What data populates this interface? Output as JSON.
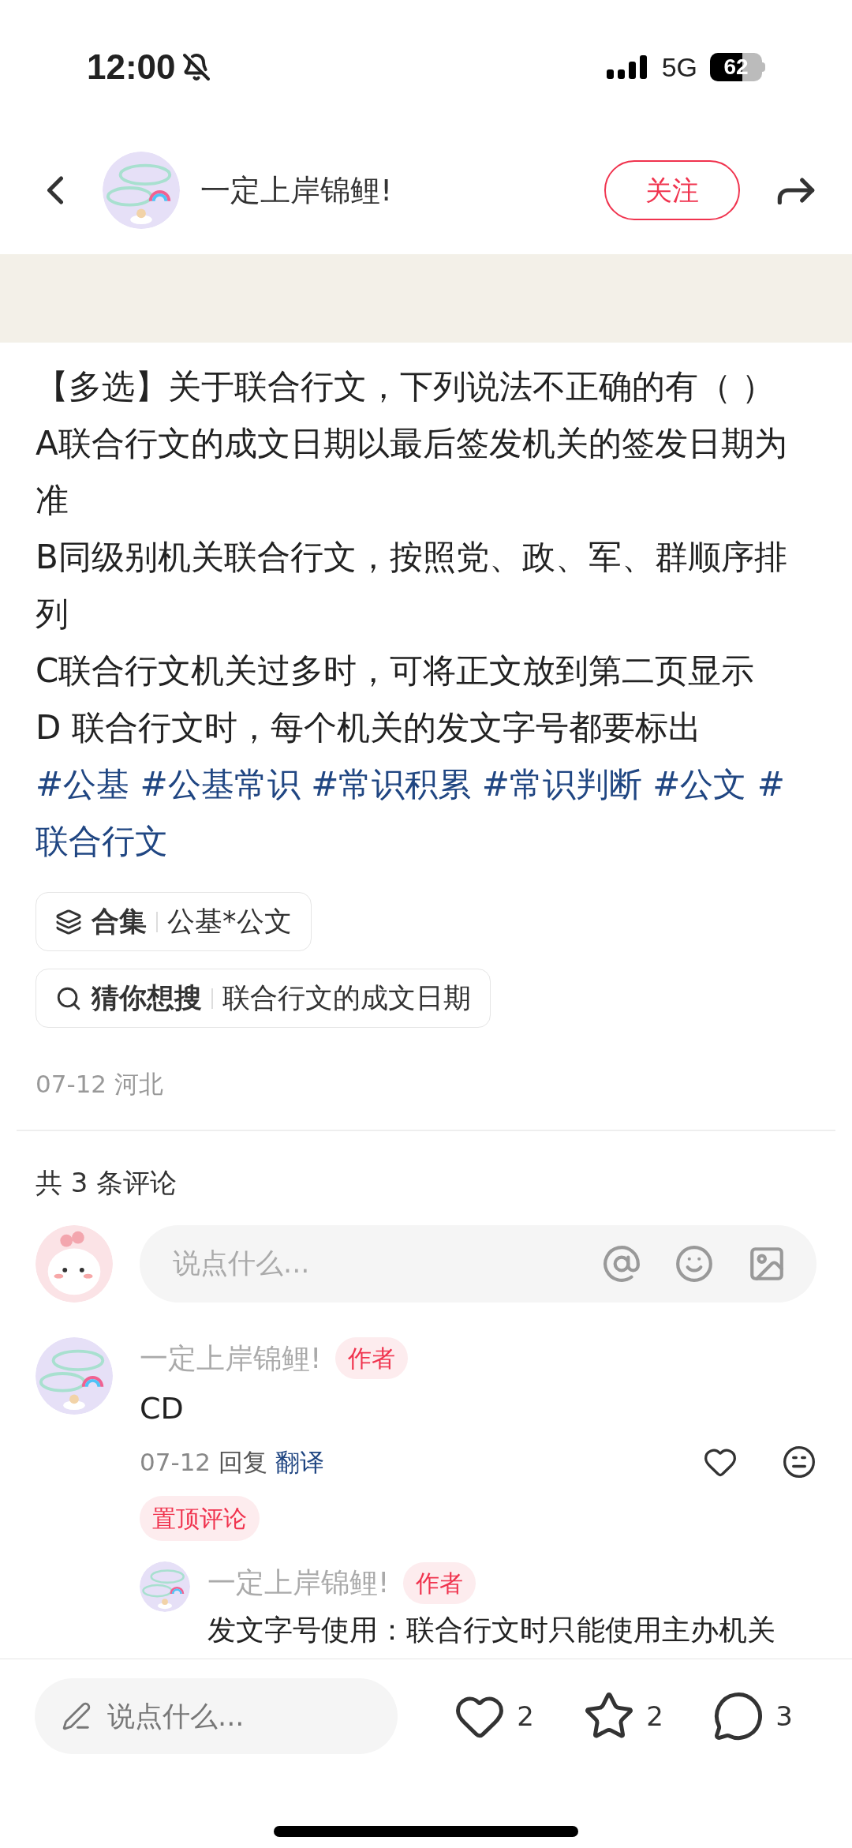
{
  "status_bar": {
    "time": "12:00",
    "network": "5G",
    "battery": "62"
  },
  "header": {
    "author": "一定上岸锦鲤!",
    "follow_button": "关注"
  },
  "post": {
    "lines": [
      "【多选】关于联合行文，下列说法不正确的有（    ）",
      "A联合行文的成文日期以最后签发机关的签发日期为准",
      "B同级别机关联合行文，按照党、政、军、群顺序排列",
      "C联合行文机关过多时，可将正文放到第二页显示",
      "D 联合行文时，每个机关的发文字号都要标出"
    ],
    "hashtags": [
      "#公基",
      "#公基常识",
      "#常识积累",
      "#常识判断",
      "#公文",
      "#联合行文"
    ],
    "chips": [
      {
        "kind": "collection",
        "label": "合集",
        "value": "公基*公文"
      },
      {
        "kind": "search",
        "label": "猜你想搜",
        "value": "联合行文的成文日期"
      }
    ],
    "meta": "07-12 河北"
  },
  "comments": {
    "count_title": "共 3 条评论",
    "input_placeholder": "说点什么...",
    "items": [
      {
        "author": "一定上岸锦鲤!",
        "badge": "作者",
        "text": "CD",
        "date": "07-12",
        "reply": "回复",
        "translate": "翻译",
        "pinned": "置顶评论",
        "replies": [
          {
            "author": "一定上岸锦鲤!",
            "badge": "作者",
            "text": "发文字号使用：联合行文时只能使用主办机关"
          }
        ]
      }
    ]
  },
  "bottom_bar": {
    "placeholder": "说点什么...",
    "likes": "2",
    "stars": "2",
    "comments": "3"
  }
}
